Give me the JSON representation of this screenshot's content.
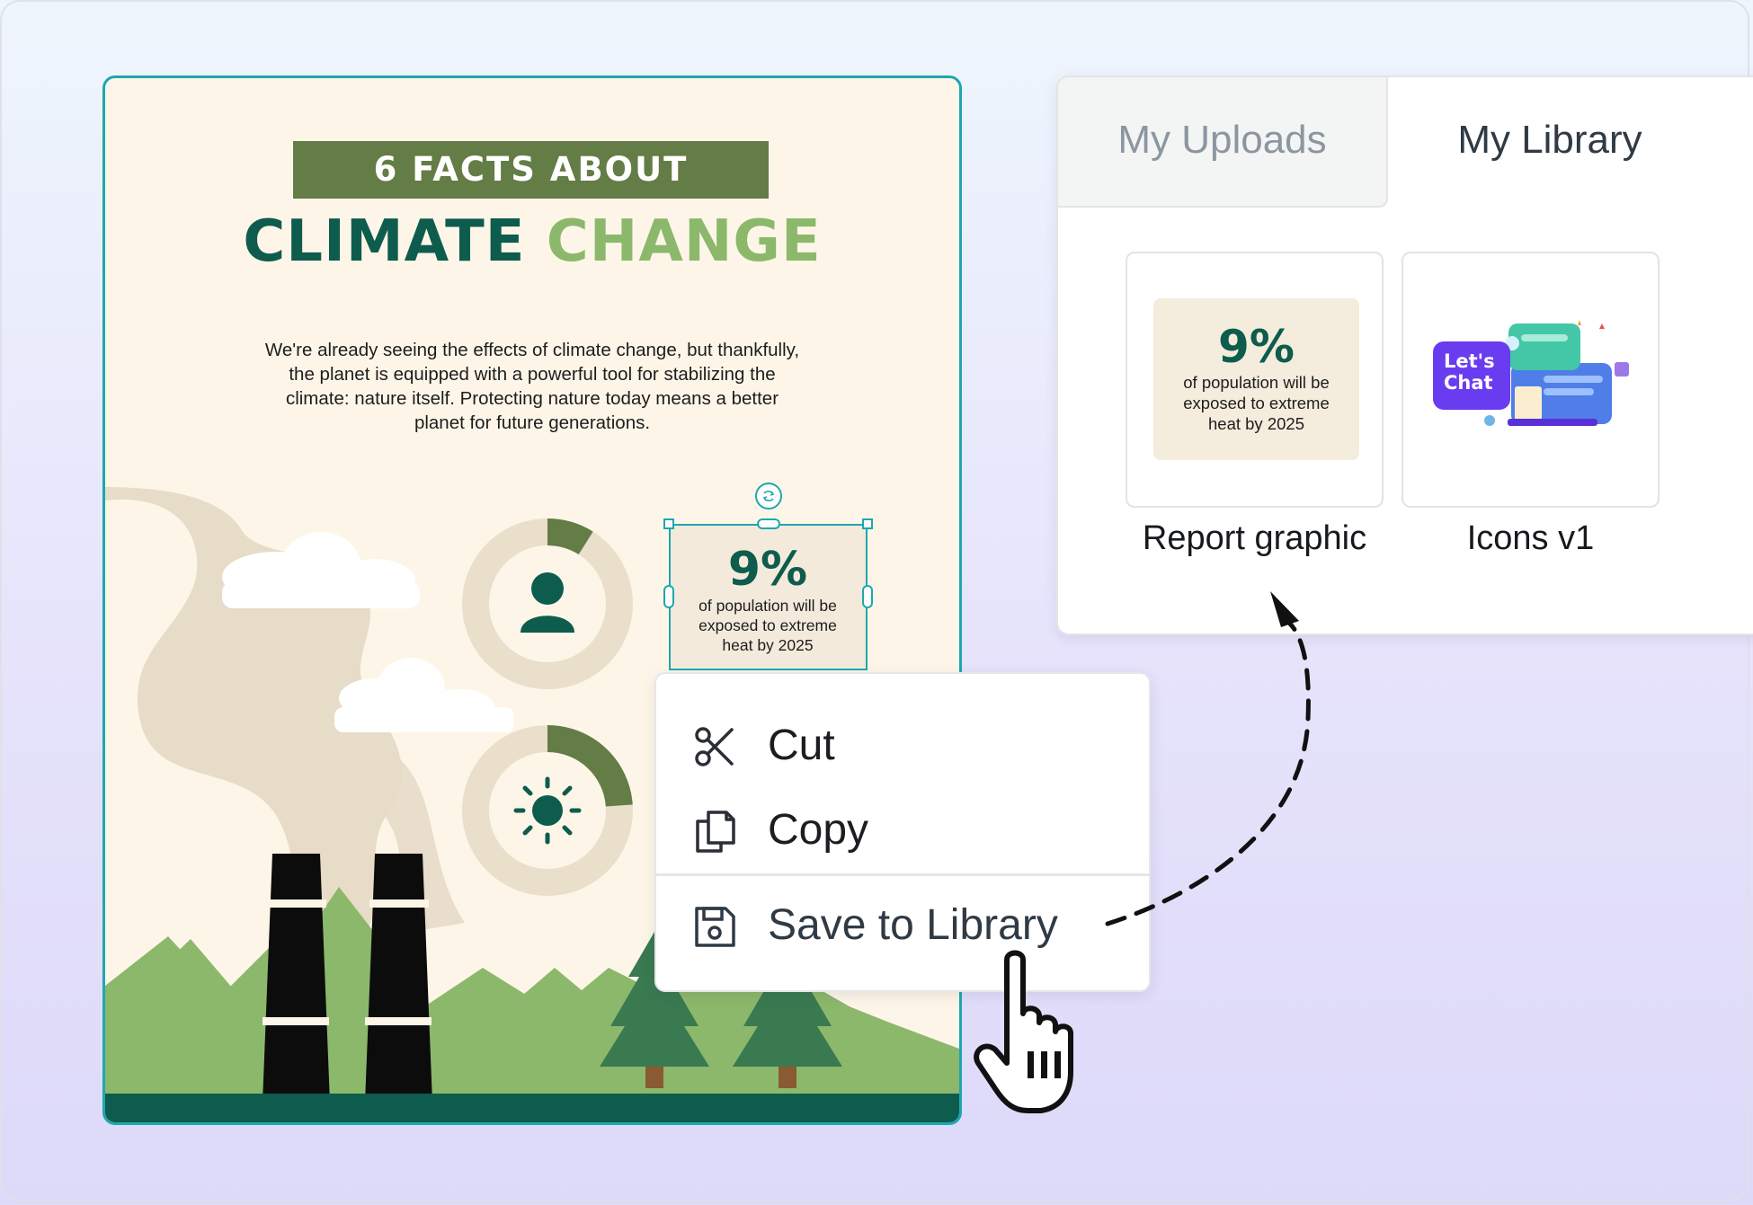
{
  "infographic": {
    "banner": "6 FACTS ABOUT",
    "headline_part1": "CLIMATE",
    "headline_part2": "CHANGE",
    "intro_line1": "We're already seeing the effects of climate change, but thankfully,",
    "intro_line2": "the planet is equipped with a powerful tool for stabilizing the",
    "intro_line3": "climate: nature itself. Protecting nature today means a better",
    "intro_line4": "planet for future generations.",
    "stat_value": "9%",
    "stat_caption_line1": "of population will be",
    "stat_caption_line2": "exposed to extreme",
    "stat_caption_line3": "heat by 2025"
  },
  "panel": {
    "tabs": [
      {
        "label": "My Uploads",
        "active": false
      },
      {
        "label": "My Library",
        "active": true
      }
    ],
    "items": [
      {
        "label": "Report graphic",
        "thumb_value": "9%",
        "thumb_caption_line1": "of population will be",
        "thumb_caption_line2": "exposed to extreme",
        "thumb_caption_line3": "heat by 2025"
      },
      {
        "label": "Icons v1",
        "thumb_text_line1": "Let's",
        "thumb_text_line2": "Chat"
      }
    ]
  },
  "context_menu": {
    "items": [
      {
        "label": "Cut",
        "icon": "scissors-icon"
      },
      {
        "label": "Copy",
        "icon": "copy-icon"
      },
      {
        "label": "Save to Library",
        "icon": "floppy-disk-icon"
      }
    ]
  },
  "colors": {
    "canvas_background": "#fdf6e8",
    "dark_green": "#0e5c4d",
    "banner_green": "#647c45",
    "light_green": "#8cb86b",
    "selection_teal": "#1ea7b0"
  }
}
